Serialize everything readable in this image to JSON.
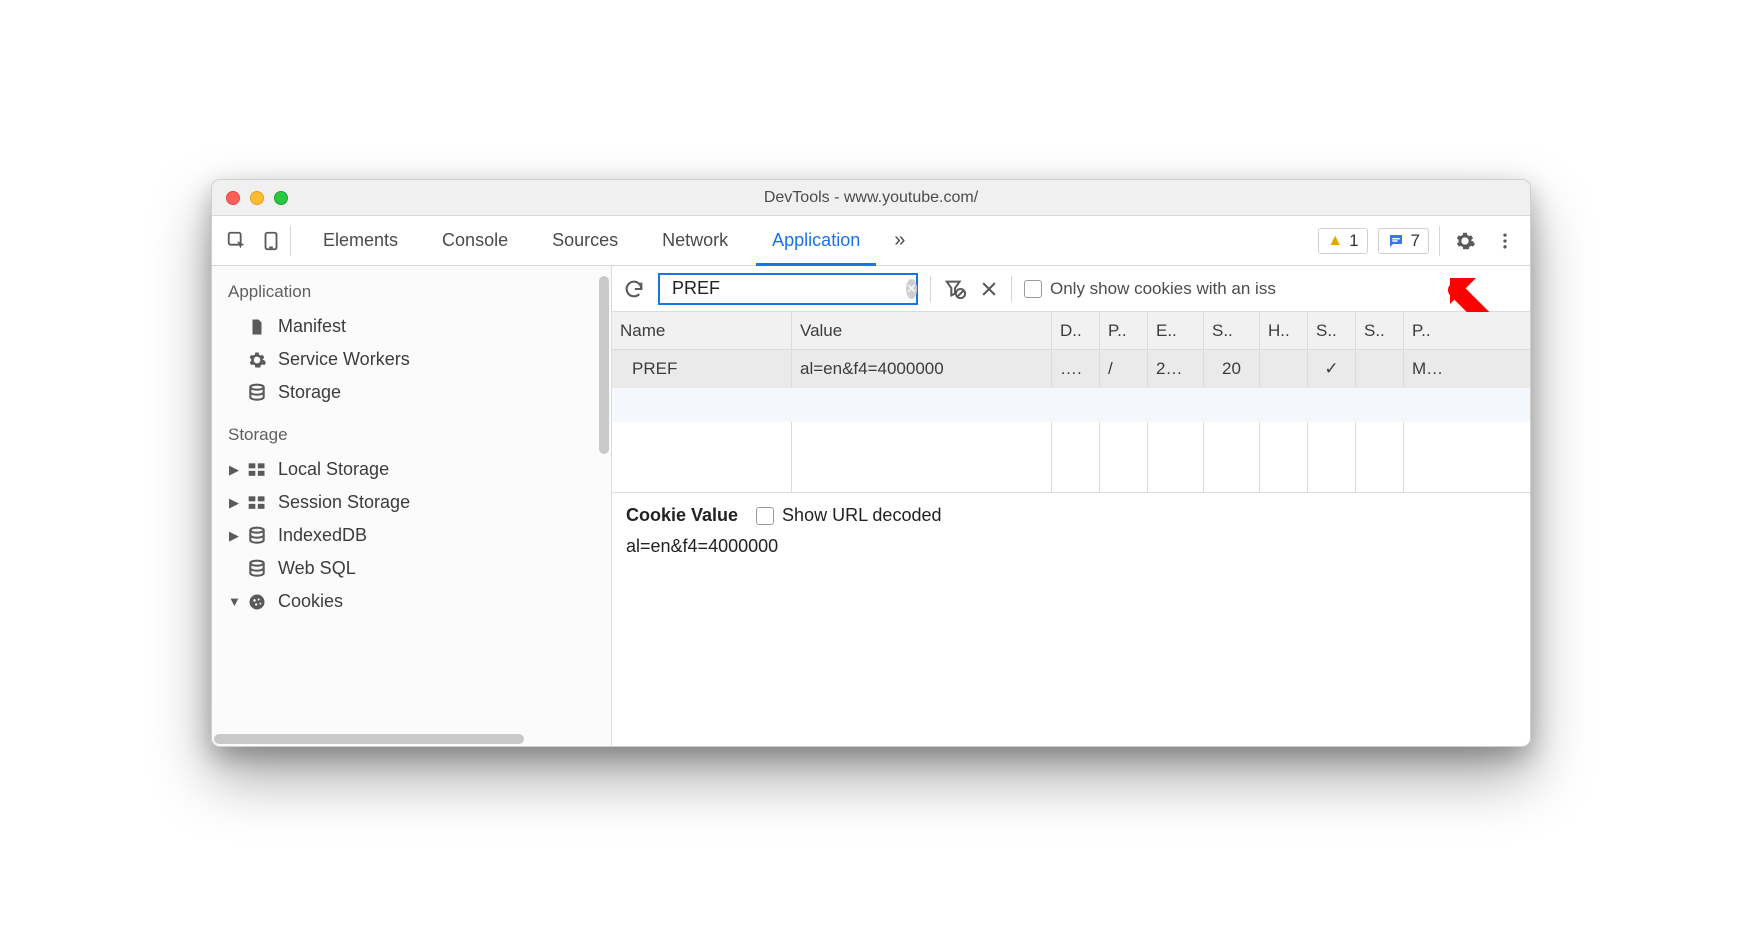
{
  "window": {
    "title": "DevTools - www.youtube.com/"
  },
  "toolbar": {
    "tabs": [
      "Elements",
      "Console",
      "Sources",
      "Network",
      "Application"
    ],
    "active_tab": "Application",
    "overflow_label": "»",
    "warn_badge": "1",
    "info_badge": "7"
  },
  "sidebar": {
    "groups": [
      {
        "title": "Application",
        "items": [
          {
            "icon": "file",
            "label": "Manifest"
          },
          {
            "icon": "gear",
            "label": "Service Workers"
          },
          {
            "icon": "storage",
            "label": "Storage"
          }
        ]
      },
      {
        "title": "Storage",
        "items": [
          {
            "icon": "grid",
            "label": "Local Storage",
            "disclosure": "▶"
          },
          {
            "icon": "grid",
            "label": "Session Storage",
            "disclosure": "▶"
          },
          {
            "icon": "storage",
            "label": "IndexedDB",
            "disclosure": "▶"
          },
          {
            "icon": "storage",
            "label": "Web SQL"
          },
          {
            "icon": "cookie",
            "label": "Cookies",
            "disclosure": "▼"
          }
        ]
      }
    ]
  },
  "main": {
    "filter_value": "PREF",
    "only_issues_label": "Only show cookies with an iss",
    "columns": [
      "Name",
      "Value",
      "D..",
      "P..",
      "E..",
      "S..",
      "H..",
      "S..",
      "S..",
      "P.."
    ],
    "rows": [
      {
        "name": "PREF",
        "value": "al=en&f4=4000000",
        "d": "….",
        "p": "/",
        "e": "2…",
        "s": "20",
        "h": "",
        "s2": "✓",
        "s3": "",
        "pr": "M…"
      }
    ],
    "value_panel": {
      "title": "Cookie Value",
      "show_decoded_label": "Show URL decoded",
      "value": "al=en&f4=4000000"
    }
  }
}
